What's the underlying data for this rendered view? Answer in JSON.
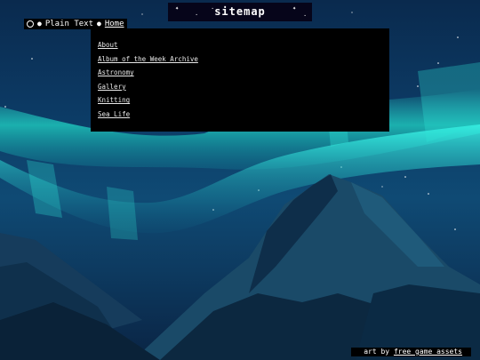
{
  "site": {
    "title": "sitemap"
  },
  "topnav": {
    "items": [
      "Plain Text",
      "Home"
    ]
  },
  "sitemap": {
    "links": [
      "About",
      "Album of the Week Archive",
      "Astronomy",
      "Gallery",
      "Knitting",
      "Sea Life"
    ]
  },
  "footer": {
    "prefix": "art by ",
    "link_label": "free game assets"
  },
  "colors": {
    "sky_top": "#0a2a4e",
    "aurora": "#1fd6c8",
    "mountain_dark": "#0b2a44",
    "mountain_mid": "#1d4f6e",
    "panel_bg": "#000000",
    "text": "#ffffff"
  },
  "icons": [
    "circle-icon",
    "bullet-icon",
    "star-icon"
  ]
}
